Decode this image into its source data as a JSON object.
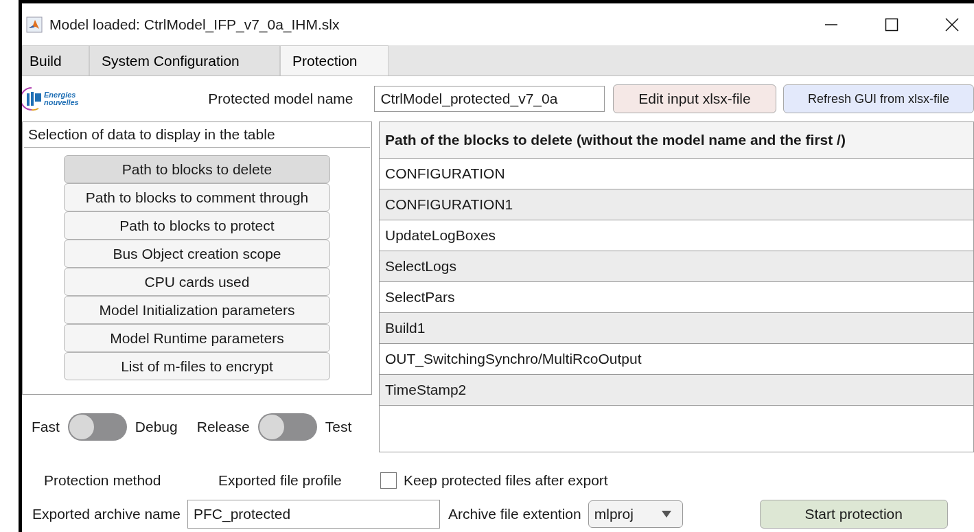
{
  "window": {
    "title": "Model loaded: CtrlModel_IFP_v7_0a_IHM.slx"
  },
  "tabs": [
    {
      "label": "Build",
      "selected": false
    },
    {
      "label": "System Configuration",
      "selected": false
    },
    {
      "label": "Protection",
      "selected": true
    }
  ],
  "logo": {
    "line_1": "Energies",
    "line_2": "nouvelles"
  },
  "protected_model_name": {
    "label": "Protected model name",
    "value": "CtrlModel_protected_v7_0a"
  },
  "buttons": {
    "edit": "Edit input xlsx-file",
    "refresh": "Refresh GUI from xlsx-file",
    "start": "Start protection"
  },
  "selection_panel": {
    "title": "Selection of data to display in the table",
    "items": [
      {
        "label": "Path to blocks to delete",
        "selected": true
      },
      {
        "label": "Path to blocks to comment through",
        "selected": false
      },
      {
        "label": "Path to blocks to protect",
        "selected": false
      },
      {
        "label": "Bus Object creation scope",
        "selected": false
      },
      {
        "label": "CPU cards used",
        "selected": false
      },
      {
        "label": "Model Initialization parameters",
        "selected": false
      },
      {
        "label": "Model Runtime parameters",
        "selected": false
      },
      {
        "label": "List of m-files to encrypt",
        "selected": false
      }
    ]
  },
  "table": {
    "columns": [
      "Path of the blocks to delete (without the model name and the first /)"
    ],
    "rows": [
      "CONFIGURATION",
      "CONFIGURATION1",
      "UpdateLogBoxes",
      "SelectLogs",
      "SelectPars",
      "Build1",
      "OUT_SwitchingSynchro/MultiRcoOutput",
      "TimeStamp2"
    ]
  },
  "switches": [
    {
      "left": "Fast",
      "right": "Debug",
      "on": false
    },
    {
      "left": "Release",
      "right": "Test",
      "on": false
    }
  ],
  "protection_method": {
    "label": "Protection method"
  },
  "exported_file_profile": {
    "label": "Exported file profile"
  },
  "keep_files": {
    "label": "Keep protected files after export",
    "checked": false
  },
  "archive_name": {
    "label": "Exported archive name",
    "value": "PFC_protected"
  },
  "archive_extension": {
    "label": "Archive file extention",
    "value": "mlproj"
  }
}
